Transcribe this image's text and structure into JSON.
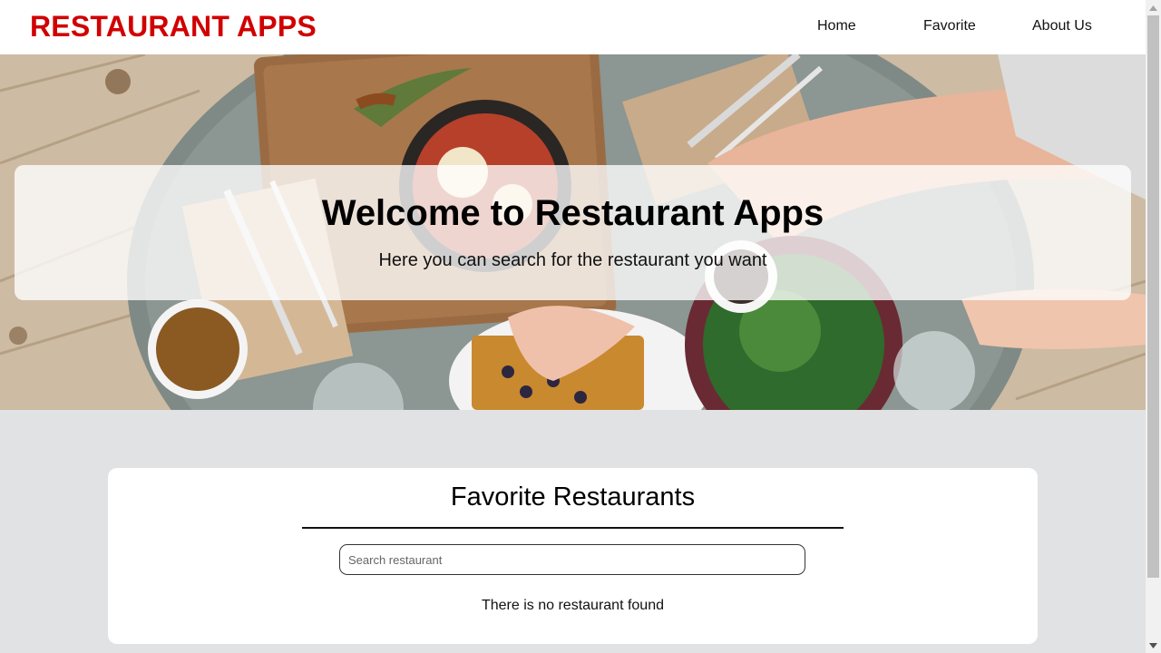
{
  "header": {
    "brand": "RESTAURANT APPS",
    "nav": [
      {
        "label": "Home"
      },
      {
        "label": "Favorite"
      },
      {
        "label": "About Us"
      }
    ]
  },
  "hero": {
    "title": "Welcome to Restaurant Apps",
    "subtitle": "Here you can search for the restaurant you want"
  },
  "content": {
    "title": "Favorite Restaurants",
    "search": {
      "placeholder": "Search restaurant",
      "value": ""
    },
    "empty_message": "There is no restaurant found"
  },
  "colors": {
    "brand": "#d10000",
    "page_background": "#e1e2e4",
    "card_background": "#ffffff"
  }
}
